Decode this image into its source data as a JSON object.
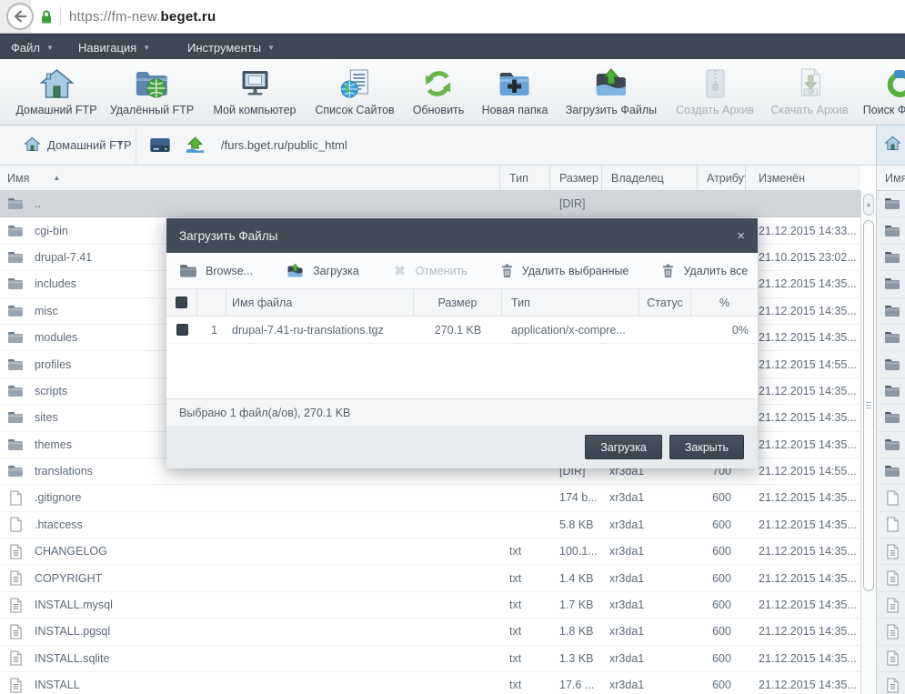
{
  "browser": {
    "url_prefix": "https://fm-new.",
    "url_domain": "beget.ru"
  },
  "menu": {
    "items": [
      {
        "label": "Файл"
      },
      {
        "label": "Навигация"
      },
      {
        "label": "Инструменты"
      }
    ]
  },
  "toolbar": {
    "items": [
      {
        "label": "Домашний FTP",
        "icon": "home",
        "disabled": false
      },
      {
        "label": "Удалённый FTP",
        "icon": "remote-ftp",
        "disabled": false
      },
      {
        "label": "Мой компьютер",
        "icon": "computer",
        "disabled": false
      },
      {
        "label": "Список Сайтов",
        "icon": "sites-list",
        "disabled": false
      },
      {
        "label": "Обновить",
        "icon": "refresh",
        "disabled": false
      },
      {
        "label": "Новая папка",
        "icon": "new-folder",
        "disabled": false
      },
      {
        "label": "Загрузить Файлы",
        "icon": "upload-files",
        "disabled": false
      },
      {
        "label": "Создать Архив",
        "icon": "create-archive",
        "disabled": true
      },
      {
        "label": "Скачать Архив",
        "icon": "download-archive",
        "disabled": true
      },
      {
        "label": "Поиск Файлов",
        "icon": "search",
        "disabled": false
      }
    ]
  },
  "pathbar": {
    "location": "Домашний FTP",
    "caret": "▾",
    "path": "/furs.bget.ru/public_html"
  },
  "columns": {
    "name": "Имя",
    "sort": "▲",
    "type": "Тип",
    "size": "Размер",
    "owner": "Владелец",
    "attr": "Атрибут",
    "modified": "Изменён"
  },
  "files": [
    {
      "name": "..",
      "icon": "folder",
      "type": "",
      "size": "[DIR]",
      "owner": "",
      "attr": "",
      "modified": "",
      "selected": true
    },
    {
      "name": "cgi-bin",
      "icon": "folder",
      "type": "",
      "size": "",
      "owner": "",
      "attr": "",
      "modified": "21.12.2015 14:33...",
      "selected": false
    },
    {
      "name": "drupal-7.41",
      "icon": "folder",
      "type": "",
      "size": "",
      "owner": "",
      "attr": "",
      "modified": "21.10.2015 23:02...",
      "selected": false
    },
    {
      "name": "includes",
      "icon": "folder",
      "type": "",
      "size": "",
      "owner": "",
      "attr": "",
      "modified": "21.12.2015 14:35...",
      "selected": false
    },
    {
      "name": "misc",
      "icon": "folder",
      "type": "",
      "size": "",
      "owner": "",
      "attr": "",
      "modified": "21.12.2015 14:35...",
      "selected": false
    },
    {
      "name": "modules",
      "icon": "folder",
      "type": "",
      "size": "",
      "owner": "",
      "attr": "",
      "modified": "21.12.2015 14:35...",
      "selected": false
    },
    {
      "name": "profiles",
      "icon": "folder",
      "type": "",
      "size": "",
      "owner": "",
      "attr": "",
      "modified": "21.12.2015 14:55...",
      "selected": false
    },
    {
      "name": "scripts",
      "icon": "folder",
      "type": "",
      "size": "",
      "owner": "",
      "attr": "",
      "modified": "21.12.2015 14:35...",
      "selected": false
    },
    {
      "name": "sites",
      "icon": "folder",
      "type": "",
      "size": "",
      "owner": "",
      "attr": "",
      "modified": "21.12.2015 14:35...",
      "selected": false
    },
    {
      "name": "themes",
      "icon": "folder",
      "type": "",
      "size": "",
      "owner": "",
      "attr": "",
      "modified": "21.12.2015 14:35...",
      "selected": false
    },
    {
      "name": "translations",
      "icon": "folder",
      "type": "",
      "size": "[DIR]",
      "owner": "xr3da1",
      "attr": "700",
      "modified": "21.12.2015 14:55...",
      "selected": false
    },
    {
      "name": ".gitignore",
      "icon": "file",
      "type": "",
      "size": "174 b...",
      "owner": "xr3da1",
      "attr": "600",
      "modified": "21.12.2015 14:35...",
      "selected": false
    },
    {
      "name": ".htaccess",
      "icon": "file",
      "type": "",
      "size": "5.8 KB",
      "owner": "xr3da1",
      "attr": "600",
      "modified": "21.12.2015 14:35...",
      "selected": false
    },
    {
      "name": "CHANGELOG",
      "icon": "textfile",
      "type": "txt",
      "size": "100.1...",
      "owner": "xr3da1",
      "attr": "600",
      "modified": "21.12.2015 14:35...",
      "selected": false
    },
    {
      "name": "COPYRIGHT",
      "icon": "textfile",
      "type": "txt",
      "size": "1.4 KB",
      "owner": "xr3da1",
      "attr": "600",
      "modified": "21.12.2015 14:35...",
      "selected": false
    },
    {
      "name": "INSTALL.mysql",
      "icon": "textfile",
      "type": "txt",
      "size": "1.7 KB",
      "owner": "xr3da1",
      "attr": "600",
      "modified": "21.12.2015 14:35...",
      "selected": false
    },
    {
      "name": "INSTALL.pgsql",
      "icon": "textfile",
      "type": "txt",
      "size": "1.8 KB",
      "owner": "xr3da1",
      "attr": "600",
      "modified": "21.12.2015 14:35...",
      "selected": false
    },
    {
      "name": "INSTALL.sqlite",
      "icon": "textfile",
      "type": "txt",
      "size": "1.3 KB",
      "owner": "xr3da1",
      "attr": "600",
      "modified": "21.12.2015 14:35...",
      "selected": false
    },
    {
      "name": "INSTALL",
      "icon": "textfile",
      "type": "txt",
      "size": "17.6 ...",
      "owner": "xr3da1",
      "attr": "600",
      "modified": "21.12.2015 14:35...",
      "selected": false
    }
  ],
  "right_panel": {
    "header": "Имя"
  },
  "modal": {
    "title": "Загрузить Файлы",
    "close_label": "×",
    "toolbar": [
      {
        "label": "Browse...",
        "icon": "browse-folder",
        "disabled": false
      },
      {
        "label": "Загрузка",
        "icon": "upload-small",
        "disabled": false
      },
      {
        "label": "Отменить",
        "icon": "cancel-x",
        "disabled": true
      },
      {
        "label": "Удалить выбранные",
        "icon": "trash",
        "disabled": false
      },
      {
        "label": "Удалить все",
        "icon": "trash",
        "disabled": false
      }
    ],
    "table": {
      "headers": {
        "name": "Имя файла",
        "size": "Размер",
        "type": "Тип",
        "status": "Статус",
        "percent": "%"
      },
      "row": {
        "num": "1",
        "name": "drupal-7.41-ru-translations.tgz",
        "size": "270.1 KB",
        "type": "application/x-compre...",
        "status": "",
        "percent": "0%"
      }
    },
    "status_text": "Выбрано 1 файл(а/ов), 270.1 KB",
    "buttons": [
      {
        "label": "Загрузка"
      },
      {
        "label": "Закрыть"
      }
    ]
  }
}
